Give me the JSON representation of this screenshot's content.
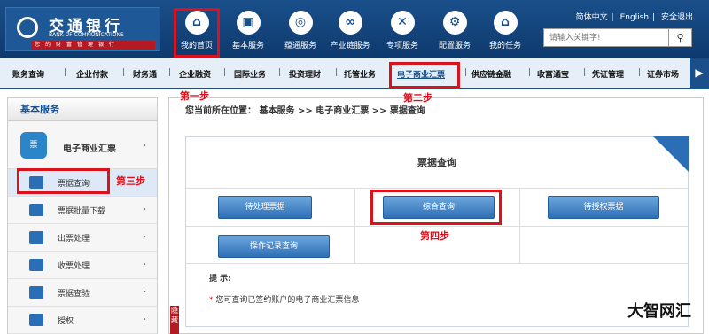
{
  "brand": {
    "name_cn": "交通银行",
    "name_en": "BANK OF COMMUNICATIONS",
    "slogan": "您的财富管理银行"
  },
  "top_nav": [
    {
      "label": "我的首页",
      "glyph": "⌂"
    },
    {
      "label": "基本服务",
      "glyph": "▣"
    },
    {
      "label": "蕴通服务",
      "glyph": "◎"
    },
    {
      "label": "产业链服务",
      "glyph": "∞"
    },
    {
      "label": "专项服务",
      "glyph": "✕"
    },
    {
      "label": "配置服务",
      "glyph": "⚙"
    },
    {
      "label": "我的任务",
      "glyph": "⌂"
    }
  ],
  "top_links": {
    "simplified": "简体中文",
    "english": "English",
    "logout": "安全退出"
  },
  "search": {
    "placeholder": "请输入关键字!",
    "icon": "search-icon"
  },
  "sub_nav": [
    "账务查询",
    "企业付款",
    "财务通",
    "企业融资",
    "国际业务",
    "投资理财",
    "托管业务",
    "电子商业汇票",
    "供应链金融",
    "收富通宝",
    "凭证管理",
    "证券市场"
  ],
  "steps": {
    "step1": "第一步",
    "step2": "第二步",
    "step3": "第三步",
    "step4": "第四步"
  },
  "sidebar": {
    "title": "基本服务",
    "main": "电子商业汇票",
    "items": [
      "票据查询",
      "票据批量下载",
      "出票处理",
      "收票处理",
      "票据查验",
      "授权"
    ]
  },
  "content": {
    "breadcrumb": "您当前所在位置：  基本服务  >>  电子商业汇票  >>  票据查询",
    "panel_title": "票据查询",
    "buttons": [
      "待处理票据",
      "综合查询",
      "待授权票据",
      "操作记录查询"
    ],
    "tip_title": "提  示:",
    "tip_text": "您可查询已签约账户的电子商业汇票信息"
  },
  "hide_tab": "隐藏",
  "watermark": "大智网汇",
  "colors": {
    "brand_blue": "#1a4f8a",
    "highlight_red": "#d9121b"
  }
}
